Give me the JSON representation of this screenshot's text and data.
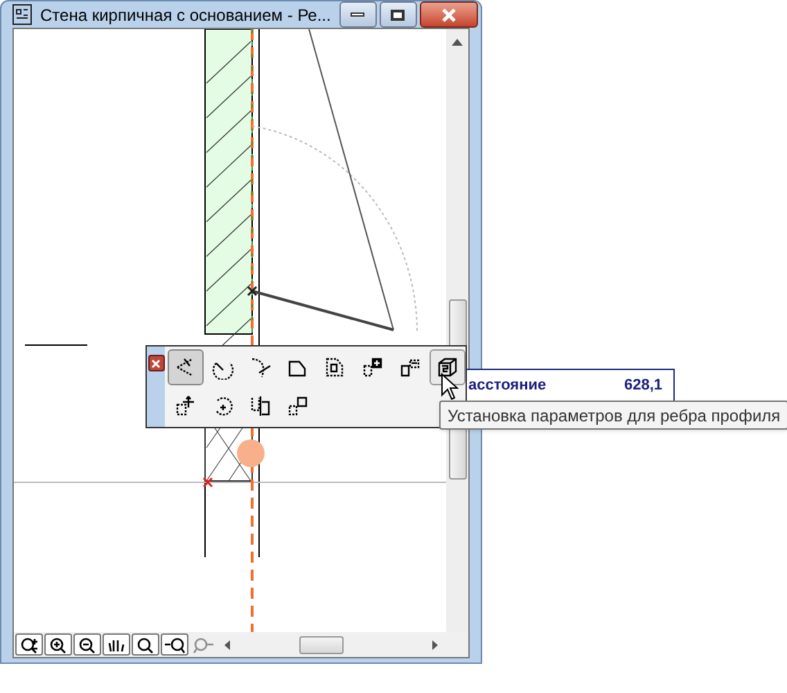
{
  "window": {
    "title": "Стена кирпичная с основанием - Ре..."
  },
  "palette": {
    "rows": [
      {
        "tools": [
          {
            "selected": true,
            "hovered": false
          },
          {
            "selected": false,
            "hovered": false
          },
          {
            "selected": false,
            "hovered": false
          },
          {
            "selected": false,
            "hovered": false
          },
          {
            "selected": false,
            "hovered": false
          },
          {
            "selected": false,
            "hovered": false
          },
          {
            "selected": false,
            "hovered": false
          },
          {
            "selected": false,
            "hovered": true
          }
        ]
      },
      {
        "tools": [
          {
            "selected": false,
            "hovered": false
          },
          {
            "selected": false,
            "hovered": false
          },
          {
            "selected": false,
            "hovered": false
          },
          {
            "selected": false,
            "hovered": false
          }
        ]
      }
    ]
  },
  "info": {
    "label": "асстояние",
    "value": "628,1"
  },
  "tooltip": "Установка параметров для ребра профиля",
  "zoom_buttons": [
    {
      "disabled": false
    },
    {
      "disabled": false
    },
    {
      "disabled": false
    },
    {
      "disabled": false
    },
    {
      "disabled": false
    },
    {
      "disabled": false
    },
    {
      "disabled": true
    }
  ]
}
